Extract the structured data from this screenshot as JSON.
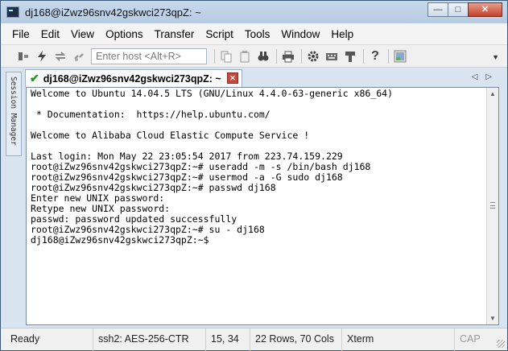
{
  "window": {
    "title": "dj168@iZwz96snv42gskwci273qpZ: ~",
    "controls": {
      "minimize": "—",
      "maximize": "□",
      "close": "✕"
    }
  },
  "menubar": {
    "items": [
      "File",
      "Edit",
      "View",
      "Options",
      "Transfer",
      "Script",
      "Tools",
      "Window",
      "Help"
    ]
  },
  "toolbar": {
    "host_placeholder": "Enter host <Alt+R>",
    "icons": [
      "connect-icon",
      "quick-connect-icon",
      "reconnect-icon",
      "disconnect-icon",
      "copy-icon",
      "paste-icon",
      "find-icon",
      "print-icon",
      "settings-icon",
      "keymap-icon",
      "sftp-icon",
      "help-icon",
      "screen-icon"
    ]
  },
  "side_panel": {
    "label": "Session Manager"
  },
  "session_tab": {
    "label": "dj168@iZwz96snv42gskwci273qpZ: ~",
    "status_icon": "connected-check-icon"
  },
  "terminal": {
    "lines": [
      "Welcome to Ubuntu 14.04.5 LTS (GNU/Linux 4.4.0-63-generic x86_64)",
      "",
      " * Documentation:  https://help.ubuntu.com/",
      "",
      "Welcome to Alibaba Cloud Elastic Compute Service !",
      "",
      "Last login: Mon May 22 23:05:54 2017 from 223.74.159.229",
      "root@iZwz96snv42gskwci273qpZ:~# useradd -m -s /bin/bash dj168",
      "root@iZwz96snv42gskwci273qpZ:~# usermod -a -G sudo dj168",
      "root@iZwz96snv42gskwci273qpZ:~# passwd dj168",
      "Enter new UNIX password:",
      "Retype new UNIX password:",
      "passwd: password updated successfully",
      "root@iZwz96snv42gskwci273qpZ:~# su - dj168",
      "dj168@iZwz96snv42gskwci273qpZ:~$"
    ]
  },
  "statusbar": {
    "ready": "Ready",
    "cipher": "ssh2: AES-256-CTR",
    "cursor": "15,  34",
    "size": "22 Rows, 70 Cols",
    "terminal_type": "Xterm",
    "caps": "CAP"
  }
}
